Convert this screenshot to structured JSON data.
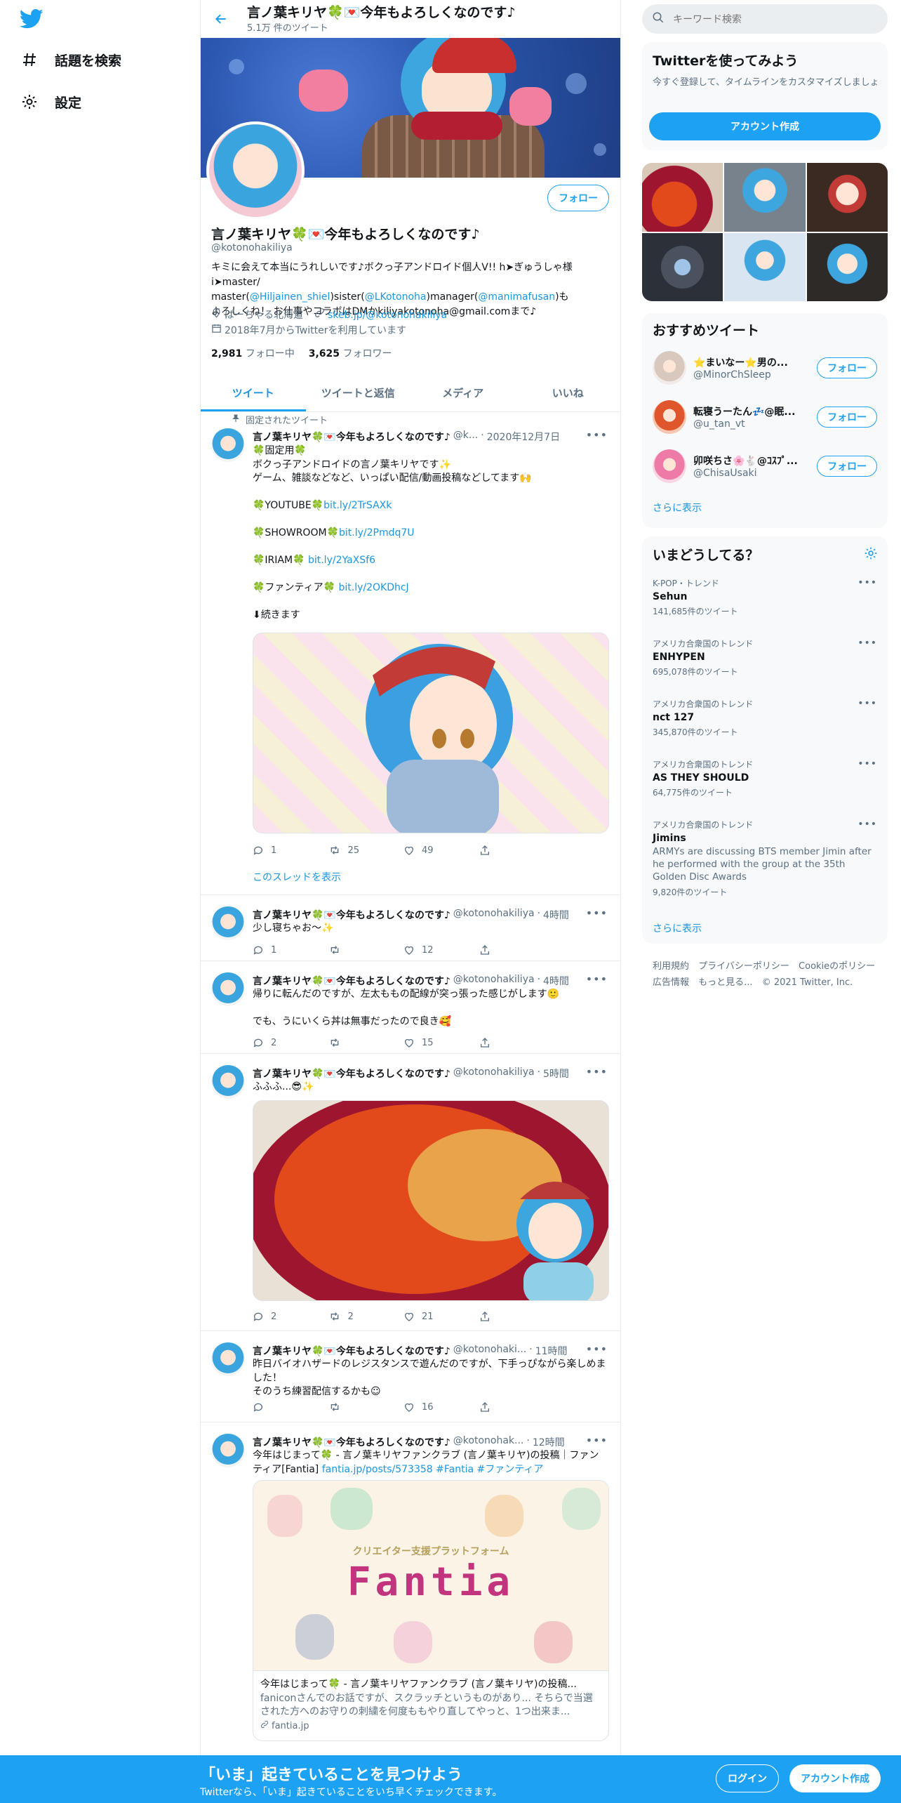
{
  "nav": {
    "explore": "話題を検索",
    "settings": "設定"
  },
  "header": {
    "title": "言ノ葉キリヤ🍀💌今年もよろしくなのです♪",
    "tweet_count": "5.1万 件のツイート"
  },
  "profile": {
    "name": "言ノ葉キリヤ🍀💌今年もよろしくなのです♪",
    "handle": "@kotonohakiliya",
    "follow": "フォロー",
    "bio_1": "キミに会えて本当にうれしいです♪ボクっ子アンドロイド個人V!! h➤ぎゅうしゃ様i➤master/ master(",
    "bio_link1": "@Hiljainen_shiel",
    "bio_2": ")sister(",
    "bio_link2": "@LKotonoha",
    "bio_3": ")manager(",
    "bio_link3": "@manimafusan",
    "bio_4": ")も",
    "bio_5": "よろしくね！ お仕事やコラボはDMかkiliyakotonoha@gmail.comまで♪",
    "location": "ぱーちゃる北海道",
    "website": "skeb.jp/@kotonohakiliya",
    "joined": "2018年7月からTwitterを利用しています",
    "following_count": "2,981",
    "following_label": "フォロー中",
    "followers_count": "3,625",
    "followers_label": "フォロワー"
  },
  "tabs": [
    "ツイート",
    "ツイートと返信",
    "メディア",
    "いいね"
  ],
  "tweets": [
    {
      "pinned_label": "固定されたツイート",
      "name": "言ノ葉キリヤ🍀💌今年もよろしくなのです♪",
      "handle": "@k...",
      "time": "2020年12月7日",
      "text_1": "🍀固定用🍀\nボクっ子アンドロイドの言ノ葉キリヤです✨\nゲーム、雑談などなど、いっぱい配信/動画投稿などしてます🙌\n\n🍀YOUTUBE🍀",
      "link_1": "bit.ly/2TrSAXk",
      "text_2": "🍀SHOWROOM🍀",
      "link_2": "bit.ly/2Pmdq7U",
      "text_3": "🍀IRIAM🍀 ",
      "link_3": "bit.ly/2YaXSf6",
      "text_4": "🍀ファンティア🍀 ",
      "link_4": "bit.ly/2OKDhcJ",
      "text_5": "⬇続きます",
      "replies": "1",
      "retweets": "25",
      "likes": "49",
      "thread": "このスレッドを表示"
    },
    {
      "name": "言ノ葉キリヤ🍀💌今年もよろしくなのです♪",
      "handle": "@kotonohakiliya",
      "time": "4時間",
      "text": "少し寝ちゃお～✨",
      "replies": "1",
      "retweets": "",
      "likes": "12"
    },
    {
      "name": "言ノ葉キリヤ🍀💌今年もよろしくなのです♪",
      "handle": "@kotonohakiliya",
      "time": "4時間",
      "text": "帰りに転んだのですが、左太ももの配線が突っ張った感じがします🙂\n\nでも、うにいくら丼は無事だったので良き🥰",
      "replies": "2",
      "retweets": "",
      "likes": "15"
    },
    {
      "name": "言ノ葉キリヤ🍀💌今年もよろしくなのです♪",
      "handle": "@kotonohakiliya",
      "time": "5時間",
      "text": "ふふふ...😎✨",
      "replies": "2",
      "retweets": "2",
      "likes": "21"
    },
    {
      "name": "言ノ葉キリヤ🍀💌今年もよろしくなのです♪",
      "handle": "@kotonohaki...",
      "time": "11時間",
      "text": "昨日バイオハザードのレジスタンスで遊んだのですが、下手っぴながら楽しめました！\nそのうち練習配信するかも☺",
      "replies": "",
      "retweets": "",
      "likes": "16"
    },
    {
      "name": "言ノ葉キリヤ🍀💌今年もよろしくなのです♪",
      "handle": "@kotonohak...",
      "time": "12時間",
      "text_1": "今年はじまって🍀 - 言ノ葉キリヤファンクラブ (言ノ葉キリヤ)の投稿｜ファンティア[Fantia] ",
      "link_1": "fantia.jp/posts/573358",
      "tags": " #Fantia #ファンティア",
      "card_banner": "クリエイター支援プラットフォーム",
      "card_logo": "Fantia",
      "card_title": "今年はじまって🍀 - 言ノ葉キリヤファンクラブ (言ノ葉キリヤ)の投稿...",
      "card_desc": "faniconさんでのお話ですが、スクラッチというものがあり... そちらで当選された方へのお守りの刺繍を何度ももやり直してやっと、1つ出来ま...",
      "card_domain": "fantia.jp"
    }
  ],
  "sidebar": {
    "search_placeholder": "キーワード検索",
    "signup_title": "Twitterを使ってみよう",
    "signup_desc": "今すぐ登録して、タイムラインをカスタマイズしましょう。",
    "signup_button": "アカウント作成",
    "recommend_title": "おすすめツイート",
    "recommend": [
      {
        "name": "⭐まいなー⭐男の...",
        "handle": "@MinorChSleep",
        "follow": "フォロー"
      },
      {
        "name": "転寝うーたん💤@眠...",
        "handle": "@u_tan_vt",
        "follow": "フォロー"
      },
      {
        "name": "卯咲ちさ🌸🐇@ｺｽﾌﾟ...",
        "handle": "@ChisaUsaki",
        "follow": "フォロー"
      }
    ],
    "show_more": "さらに表示",
    "trends_title": "いまどうしてる？",
    "trends": [
      {
        "cat": "K-POP・トレンド",
        "topic": "Sehun",
        "desc": "",
        "count": "141,685件のツイート"
      },
      {
        "cat": "アメリカ合衆国のトレンド",
        "topic": "ENHYPEN",
        "desc": "",
        "count": "695,078件のツイート"
      },
      {
        "cat": "アメリカ合衆国のトレンド",
        "topic": "nct 127",
        "desc": "",
        "count": "345,870件のツイート"
      },
      {
        "cat": "アメリカ合衆国のトレンド",
        "topic": "AS THEY SHOULD",
        "desc": "",
        "count": "64,775件のツイート"
      },
      {
        "cat": "アメリカ合衆国のトレンド",
        "topic": "Jimins",
        "desc": "ARMYs are discussing BTS member Jimin after he performed with the group at the 35th Golden Disc Awards",
        "count": "9,820件のツイート"
      }
    ],
    "trends_more": "さらに表示",
    "footer": [
      "利用規約",
      "プライバシーポリシー",
      "Cookieのポリシー",
      "広告情報",
      "もっと見る...",
      "© 2021 Twitter, Inc."
    ]
  },
  "bottom": {
    "title": "「いま」起きていることを見つけよう",
    "subtitle": "Twitterなら、「いま」起きていることをいち早くチェックできます。",
    "login": "ログイン",
    "create": "アカウント作成"
  },
  "colors": {
    "accent": "#1da1f2",
    "link": "#1b95e0",
    "muted": "#5b7083"
  }
}
